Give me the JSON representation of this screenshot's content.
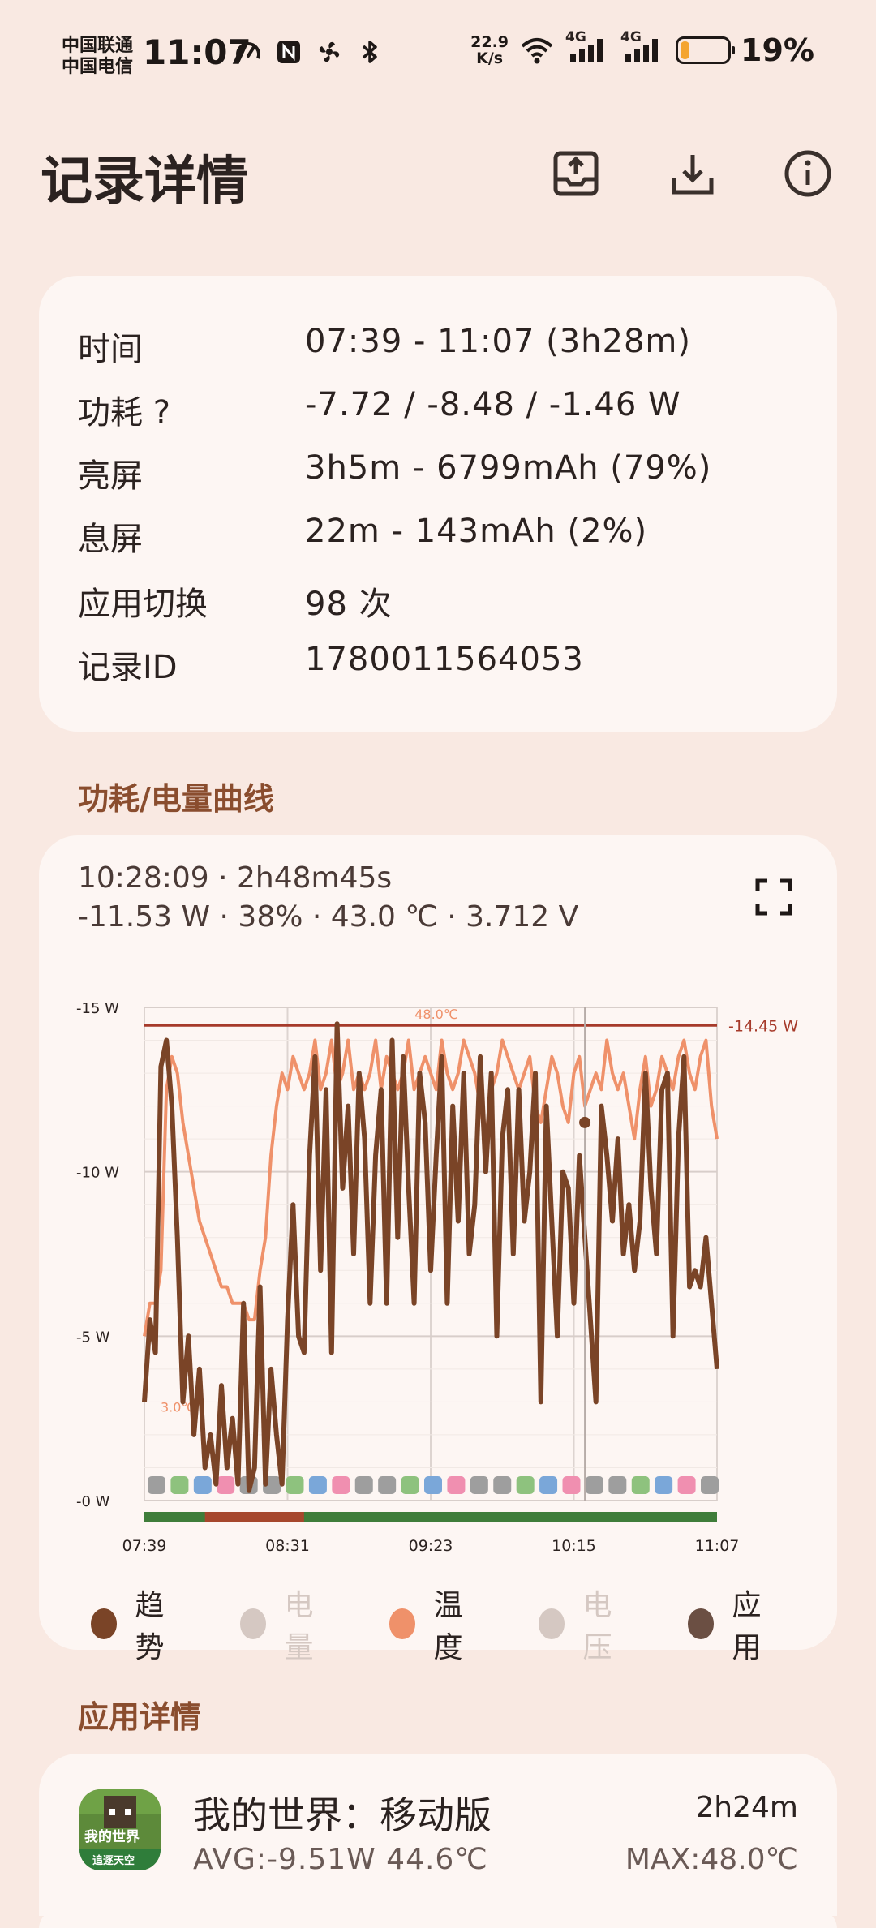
{
  "status_bar": {
    "carrier_1": "中国联通",
    "carrier_2": "中国电信",
    "time": "11:07",
    "net_speed_value": "22.9",
    "net_speed_unit": "K/s",
    "signal_label_1": "4G",
    "signal_label_2": "4G",
    "battery_percent": "19%",
    "battery_level": 0.19,
    "battery_color": "#f4a430",
    "icons": [
      "speedometer-icon",
      "nfc-icon",
      "fan-icon",
      "bluetooth-icon",
      "wifi-icon",
      "signal-icon",
      "battery-icon"
    ]
  },
  "app_bar": {
    "title": "记录详情",
    "actions": [
      "upload-icon",
      "download-icon",
      "info-icon"
    ]
  },
  "summary": {
    "rows": [
      {
        "label": "时间",
        "value": "07:39 - 11:07 (3h28m)"
      },
      {
        "label": "功耗 ?",
        "value": "-7.72 / -8.48 / -1.46 W"
      },
      {
        "label": "亮屏",
        "value": "3h5m - 6799mAh (79%)"
      },
      {
        "label": "息屏",
        "value": "22m - 143mAh (2%)"
      },
      {
        "label": "应用切换",
        "value": "98 次"
      },
      {
        "label": "记录ID",
        "value": "1780011564053"
      }
    ]
  },
  "chart_section": {
    "title": "功耗/电量曲线",
    "header_line1": "10:28:09 · 2h48m45s",
    "header_line2": "-11.53 W · 38% · 43.0 ℃ · 3.712 V",
    "legend": [
      {
        "label": "趋势",
        "color": "#7a4427",
        "active": true
      },
      {
        "label": "电量",
        "color": "#d5c8c2",
        "active": false
      },
      {
        "label": "温度",
        "color": "#ef916a",
        "active": true
      },
      {
        "label": "电压",
        "color": "#d5c8c2",
        "active": false
      },
      {
        "label": "应用",
        "color": "#6b4f43",
        "active": true
      }
    ]
  },
  "chart_data": {
    "type": "line",
    "x_ticks": [
      "07:39",
      "08:31",
      "09:23",
      "10:15",
      "11:07"
    ],
    "y_ticks": [
      "-15 W",
      "-10 W",
      "-5 W",
      "-0 W"
    ],
    "ylim": [
      0,
      -15
    ],
    "max_line_label": "-14.45 W",
    "max_line_value": -14.45,
    "temp_max_label": "48.0℃",
    "temp_min_label": "3.0℃",
    "x": [
      0,
      2,
      4,
      6,
      8,
      10,
      12,
      14,
      16,
      18,
      20,
      22,
      24,
      26,
      28,
      30,
      32,
      34,
      36,
      38,
      40,
      42,
      44,
      46,
      48,
      50,
      52,
      54,
      56,
      58,
      60,
      62,
      64,
      66,
      68,
      70,
      72,
      74,
      76,
      78,
      80,
      82,
      84,
      86,
      88,
      90,
      92,
      94,
      96,
      98,
      100,
      102,
      104,
      106,
      108,
      110,
      112,
      114,
      116,
      118,
      120,
      122,
      124,
      126,
      128,
      130,
      132,
      134,
      136,
      138,
      140,
      142,
      144,
      146,
      148,
      150,
      152,
      154,
      156,
      158,
      160,
      162,
      164,
      166,
      168,
      170,
      172,
      174,
      176,
      178,
      180,
      182,
      184,
      186,
      188,
      190,
      192,
      194,
      196,
      198,
      200,
      202,
      204,
      206,
      208
    ],
    "series": [
      {
        "name": "趋势",
        "values": [
          -3.0,
          -5.5,
          -4.5,
          -13.2,
          -14.0,
          -12.0,
          -8.0,
          -3.0,
          -5.0,
          -2.0,
          -4.0,
          -1.0,
          -2.0,
          -0.5,
          -3.5,
          -1.0,
          -2.5,
          -0.5,
          -6.0,
          -0.3,
          -1.0,
          -6.5,
          -0.5,
          -4.0,
          -2.0,
          -0.5,
          -5.5,
          -9.0,
          -5.0,
          -4.5,
          -10.5,
          -13.5,
          -7.0,
          -12.5,
          -4.5,
          -14.5,
          -9.5,
          -12.0,
          -7.5,
          -13.0,
          -11.0,
          -6.0,
          -10.5,
          -12.5,
          -6.0,
          -14.0,
          -8.0,
          -13.5,
          -9.5,
          -6.0,
          -13.0,
          -11.5,
          -7.0,
          -10.5,
          -13.5,
          -6.0,
          -12.0,
          -8.5,
          -13.0,
          -7.5,
          -9.0,
          -13.5,
          -10.0,
          -13.0,
          -5.0,
          -11.0,
          -12.5,
          -7.5,
          -12.5,
          -8.5,
          -10.0,
          -13.0,
          -3.0,
          -12.0,
          -8.5,
          -5.0,
          -10.0,
          -9.5,
          -6.0,
          -10.5,
          -8.0,
          -5.5,
          -3.0,
          -12.0,
          -10.5,
          -8.5,
          -11.0,
          -7.5,
          -9.0,
          -7.0,
          -8.5,
          -13.0,
          -9.5,
          -7.5,
          -12.5,
          -13.0,
          -5.0,
          -11.0,
          -13.5,
          -6.5,
          -7.0,
          -6.5,
          -8.0,
          -6.0,
          -4.0
        ]
      },
      {
        "name": "温度",
        "values": [
          -5.0,
          -6.0,
          -6.0,
          -7.0,
          -12.5,
          -13.5,
          -13.0,
          -11.5,
          -10.5,
          -9.5,
          -8.5,
          -8.0,
          -7.5,
          -7.0,
          -6.5,
          -6.5,
          -6.0,
          -6.0,
          -6.0,
          -5.5,
          -5.5,
          -7.0,
          -8.0,
          -10.5,
          -12.0,
          -13.0,
          -12.5,
          -13.5,
          -13.0,
          -12.5,
          -13.0,
          -14.0,
          -12.5,
          -13.0,
          -14.0,
          -12.5,
          -13.0,
          -14.0,
          -12.5,
          -13.0,
          -12.5,
          -13.0,
          -14.0,
          -12.5,
          -13.5,
          -13.0,
          -12.5,
          -13.0,
          -14.0,
          -12.5,
          -13.0,
          -13.5,
          -13.0,
          -12.5,
          -14.0,
          -13.0,
          -12.5,
          -13.0,
          -14.0,
          -13.5,
          -13.0,
          -12.0,
          -11.0,
          -12.5,
          -13.0,
          -14.0,
          -13.5,
          -13.0,
          -12.5,
          -13.0,
          -13.5,
          -12.0,
          -11.5,
          -12.5,
          -13.5,
          -13.0,
          -12.0,
          -11.5,
          -13.0,
          -13.5,
          -12.0,
          -12.5,
          -13.0,
          -12.5,
          -14.0,
          -13.0,
          -12.5,
          -13.0,
          -12.0,
          -11.0,
          -12.5,
          -13.5,
          -12.0,
          -12.5,
          -13.5,
          -13.0,
          -12.5,
          -13.5,
          -14.0,
          -13.0,
          -12.5,
          -13.5,
          -14.0,
          -12.0,
          -11.0
        ]
      }
    ]
  },
  "app_section": {
    "title": "应用详情",
    "apps": [
      {
        "name": "我的世界：移动版",
        "avg": "AVG:-9.51W  44.6℃",
        "duration": "2h24m",
        "max": "MAX:48.0℃",
        "icon_label": "我的世界",
        "icon_sublabel": "追逐天空"
      }
    ]
  }
}
